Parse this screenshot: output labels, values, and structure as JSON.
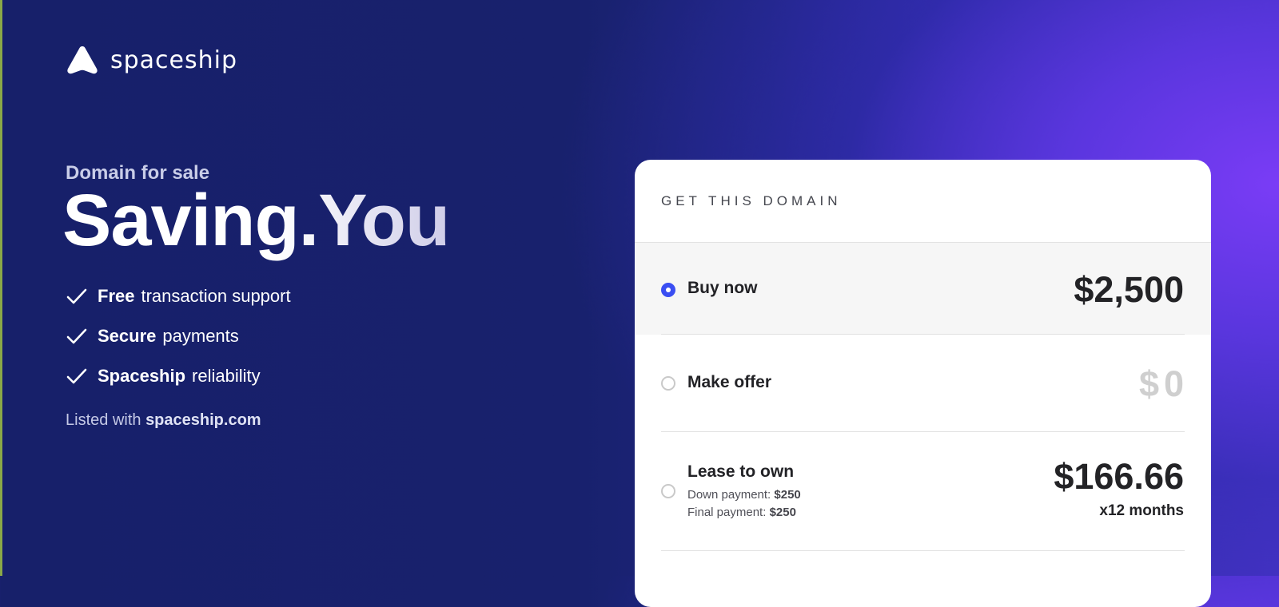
{
  "brand": {
    "name": "spaceship"
  },
  "hero": {
    "eyebrow": "Domain for sale",
    "domain": "Saving.You",
    "features": [
      {
        "bold": "Free",
        "text": "transaction support"
      },
      {
        "bold": "Secure",
        "text": "payments"
      },
      {
        "bold": "Spaceship",
        "text": "reliability"
      }
    ],
    "listed_prefix": "Listed with",
    "listed_site": "spaceship.com"
  },
  "card": {
    "title": "GET THIS DOMAIN",
    "options": [
      {
        "label": "Buy now",
        "price": "$2,500",
        "selected": true
      },
      {
        "label": "Make offer",
        "price": "$0",
        "selected": false
      },
      {
        "label": "Lease to own",
        "price": "$166.66",
        "term": "x12 months",
        "selected": false,
        "down_label": "Down payment:",
        "down_value": "$250",
        "final_label": "Final payment:",
        "final_value": "$250"
      }
    ]
  },
  "colors": {
    "accent": "#3a4ef2",
    "background_dark": "#17206a",
    "background_purple": "#7a3cf6"
  },
  "icons": {
    "logo": "spaceship-logo-icon",
    "check": "check-icon"
  }
}
